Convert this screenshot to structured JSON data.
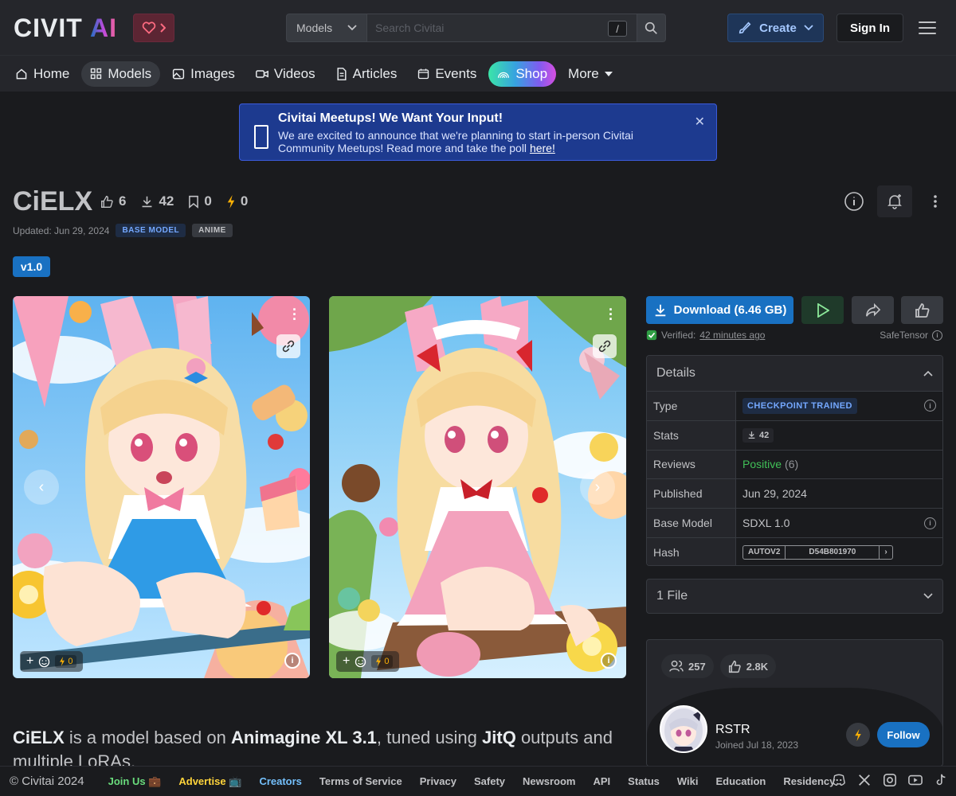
{
  "header": {
    "logo_text": "CIVITAI",
    "search_select": "Models",
    "search_placeholder": "Search Civitai",
    "search_shortcut": "/",
    "create_label": "Create",
    "signin_label": "Sign In"
  },
  "nav": {
    "home": "Home",
    "models": "Models",
    "images": "Images",
    "videos": "Videos",
    "articles": "Articles",
    "events": "Events",
    "shop": "Shop",
    "more": "More"
  },
  "banner": {
    "title": "Civitai Meetups! We Want Your Input!",
    "body": "We are excited to announce that we're planning to start in-person Civitai Community Meetups! Read more and take the poll ",
    "link": "here!"
  },
  "model": {
    "name": "CiELX",
    "likes": "6",
    "downloads": "42",
    "bookmarks": "0",
    "buzz": "0",
    "updated": "Updated: Jun 29, 2024",
    "tag_base": "BASE MODEL",
    "tag_anime": "ANIME",
    "version": "v1.0"
  },
  "gallery": [
    {
      "buzz": "0"
    },
    {
      "buzz": "0"
    }
  ],
  "download": {
    "label": "Download (6.46 GB)",
    "verified_prefix": "Verified:",
    "verified_time": "42 minutes ago",
    "format": "SafeTensor"
  },
  "details": {
    "title": "Details",
    "type_key": "Type",
    "type_val": "CHECKPOINT TRAINED",
    "stats_key": "Stats",
    "stats_val": "42",
    "reviews_key": "Reviews",
    "reviews_val": "Positive",
    "reviews_count": "(6)",
    "published_key": "Published",
    "published_val": "Jun 29, 2024",
    "base_key": "Base Model",
    "base_val": "SDXL 1.0",
    "hash_key": "Hash",
    "hash_type": "AUTOV2",
    "hash_val": "D54B801970"
  },
  "files": {
    "label": "1 File"
  },
  "creator": {
    "followers": "257",
    "likes": "2.8K",
    "name": "RSTR",
    "joined": "Joined Jul 18, 2023",
    "follow_label": "Follow"
  },
  "description": {
    "p1": "CiELX",
    "p2": " is a model based on ",
    "p3": "Animagine XL 3.1",
    "p4": ", tuned using ",
    "p5": "JitQ",
    "p6": " outputs and multiple LoRAs."
  },
  "footer": {
    "copyright": "© Civitai 2024",
    "links": [
      "Join Us 💼",
      "Advertise 📺",
      "Creators",
      "Terms of Service",
      "Privacy",
      "Safety",
      "Newsroom",
      "API",
      "Status",
      "Wiki",
      "Education",
      "Residency"
    ]
  },
  "colors": {
    "accent": "#1971c2",
    "bg": "#1a1b1e",
    "panel": "#25262b",
    "positive": "#40c057",
    "joinus": "#69db7c",
    "advertise": "#ffd43b",
    "creators": "#74c0fc"
  }
}
